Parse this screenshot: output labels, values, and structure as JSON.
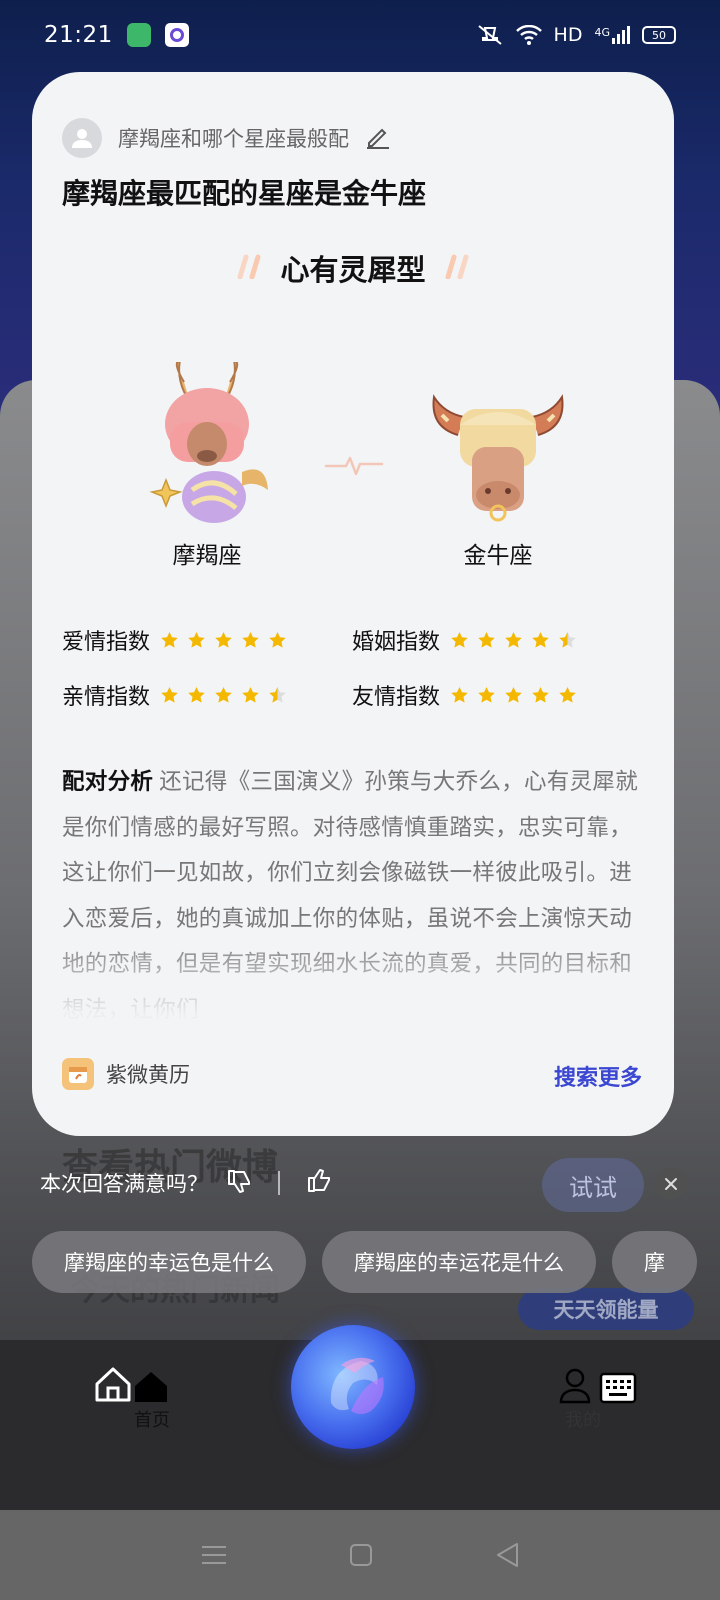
{
  "status_bar": {
    "time": "21:21",
    "network": "HD",
    "signal_type": "4G",
    "battery": "50"
  },
  "card": {
    "query": "摩羯座和哪个星座最般配",
    "answer_title": "摩羯座最匹配的星座是金牛座",
    "match_type": "心有灵犀型",
    "sign_left": "摩羯座",
    "sign_right": "金牛座",
    "ratings": [
      {
        "label": "爱情指数",
        "stars": 5
      },
      {
        "label": "婚姻指数",
        "stars": 4.5
      },
      {
        "label": "亲情指数",
        "stars": 4.5
      },
      {
        "label": "友情指数",
        "stars": 5
      }
    ],
    "analysis_label": "配对分析",
    "analysis_text": "还记得《三国演义》孙策与大乔么，心有灵犀就是你们情感的最好写照。对待感情慎重踏实，忠实可靠，这让你们一见如故，你们立刻会像磁铁一样彼此吸引。进入恋爱后，她的真诚加上你的体贴，虽说不会上演惊天动地的恋情，但是有望实现细水长流的真爱，共同的目标和想法，让你们",
    "source": "紫微黄历",
    "search_more": "搜索更多"
  },
  "background": {
    "ghost_title": "查看热门微博",
    "ghost_subtitle": "今天的热门新闻",
    "try_button": "试试",
    "energy_button": "天天领能量"
  },
  "feedback": {
    "question": "本次回答满意吗？"
  },
  "suggestions": [
    "摩羯座的幸运色是什么",
    "摩羯座的幸运花是什么",
    "摩"
  ],
  "tabs": {
    "home": "首页",
    "mine": "我的"
  },
  "colors": {
    "accent": "#3b46d1",
    "star": "#f5b800",
    "card_bg": "#f3f4f6"
  }
}
